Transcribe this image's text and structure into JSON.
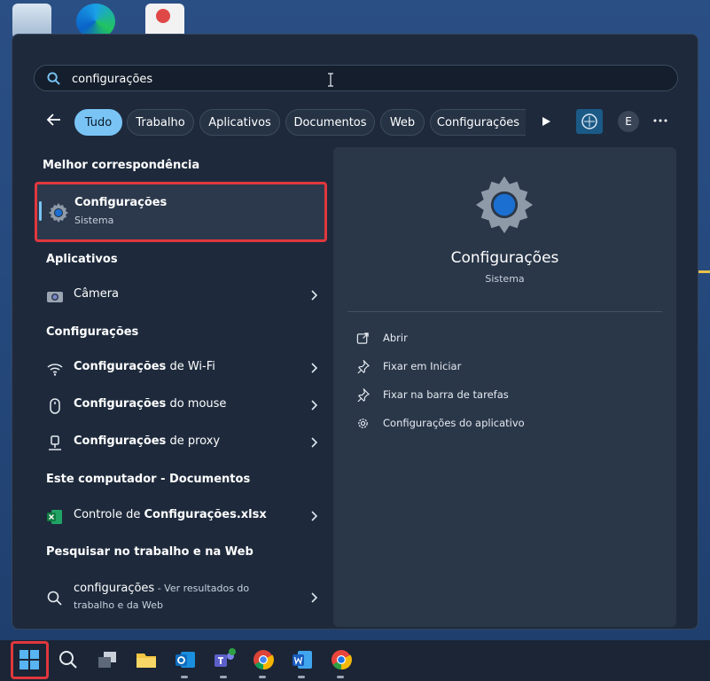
{
  "search": {
    "value": "configurações",
    "placeholder": ""
  },
  "tabs": [
    {
      "label": "Tudo",
      "active": true
    },
    {
      "label": "Trabalho"
    },
    {
      "label": "Aplicativos"
    },
    {
      "label": "Documentos"
    },
    {
      "label": "Web"
    },
    {
      "label": "Configurações"
    }
  ],
  "profile": {
    "initial": "E"
  },
  "best_match": {
    "heading": "Melhor correspondência",
    "title": "Configurações",
    "subtitle": "Sistema"
  },
  "apps": {
    "heading": "Aplicativos",
    "items": [
      {
        "label": "Câmera"
      }
    ]
  },
  "settings": {
    "heading": "Configurações",
    "items": [
      {
        "bold": "Configurações",
        "rest": " de Wi-Fi"
      },
      {
        "bold": "Configurações",
        "rest": " do mouse"
      },
      {
        "bold": "Configurações",
        "rest": " de proxy"
      }
    ]
  },
  "documents": {
    "heading": "Este computador - Documentos",
    "items": [
      {
        "pre": "Controle de ",
        "bold": "Configurações.xlsx"
      }
    ]
  },
  "web": {
    "heading": "Pesquisar no trabalho e na Web",
    "query": "configurações",
    "rest_line1": " - Ver resultados do",
    "rest_line2": "trabalho e da Web"
  },
  "preview": {
    "title": "Configurações",
    "subtitle": "Sistema",
    "actions": [
      {
        "label": "Abrir",
        "icon": "open-external-icon"
      },
      {
        "label": "Fixar em Iniciar",
        "icon": "pin-icon"
      },
      {
        "label": "Fixar na barra de tarefas",
        "icon": "pin-icon"
      },
      {
        "label": "Configurações do aplicativo",
        "icon": "gear-icon"
      }
    ]
  },
  "colors": {
    "accent": "#79c4f5",
    "highlight": "#e0383d",
    "panel": "#1e2a3c"
  }
}
